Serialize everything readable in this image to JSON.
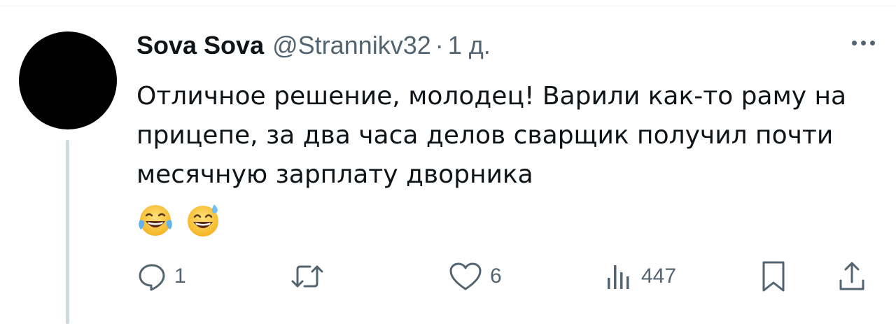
{
  "tweet": {
    "display_name": "Sova Sova",
    "handle": "@Strannikv32",
    "separator": "·",
    "timestamp": "1 д.",
    "text": "Отличное решение, молодец! Варили как-то раму на прицепе, за два часа делов сварщик получил почти месячную зарплату дворника",
    "emojis": [
      "face-with-tears-of-joy",
      "grinning-face-with-sweat"
    ]
  },
  "actions": {
    "reply_count": "1",
    "retweet_count": "",
    "like_count": "6",
    "views_count": "447"
  },
  "icons": {
    "reply": "reply-icon",
    "retweet": "retweet-icon",
    "like": "heart-icon",
    "views": "views-icon",
    "bookmark": "bookmark-icon",
    "share": "share-icon",
    "more": "more-icon"
  },
  "colors": {
    "text_primary": "#0f1419",
    "text_secondary": "#536471",
    "thread_line": "#cfd9de"
  }
}
